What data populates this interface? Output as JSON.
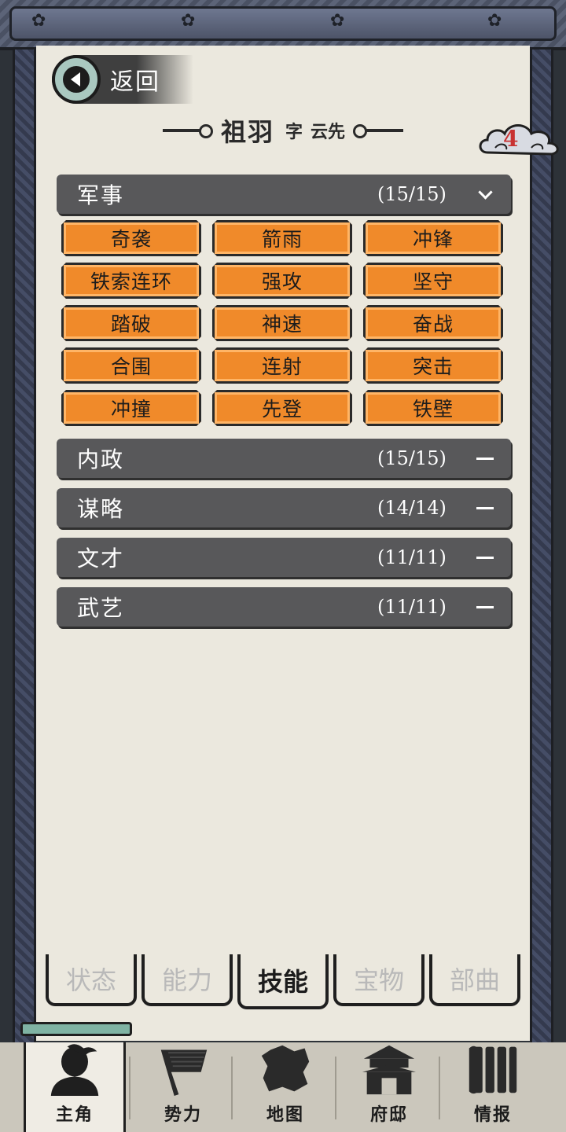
{
  "header": {
    "back_label": "返回",
    "name": "祖羽",
    "zi_label": "字",
    "zi": "云先",
    "badge_count": "4"
  },
  "categories": [
    {
      "name": "军事",
      "count": "(15/15)",
      "expanded": true,
      "skills": [
        "奇袭",
        "箭雨",
        "冲锋",
        "铁索连环",
        "强攻",
        "坚守",
        "踏破",
        "神速",
        "奋战",
        "合围",
        "连射",
        "突击",
        "冲撞",
        "先登",
        "铁壁"
      ]
    },
    {
      "name": "内政",
      "count": "(15/15)",
      "expanded": false
    },
    {
      "name": "谋略",
      "count": "(14/14)",
      "expanded": false
    },
    {
      "name": "文才",
      "count": "(11/11)",
      "expanded": false
    },
    {
      "name": "武艺",
      "count": "(11/11)",
      "expanded": false
    }
  ],
  "tabs": [
    {
      "label": "状态",
      "active": false
    },
    {
      "label": "能力",
      "active": false
    },
    {
      "label": "技能",
      "active": true
    },
    {
      "label": "宝物",
      "active": false
    },
    {
      "label": "部曲",
      "active": false
    }
  ],
  "bottom_nav": [
    {
      "label": "主角",
      "icon": "warrior-icon",
      "active": true
    },
    {
      "label": "势力",
      "icon": "flag-icon",
      "active": false
    },
    {
      "label": "地图",
      "icon": "map-icon",
      "active": false
    },
    {
      "label": "府邸",
      "icon": "mansion-icon",
      "active": false
    },
    {
      "label": "情报",
      "icon": "scroll-icon",
      "active": false
    }
  ],
  "colors": {
    "skill_orange": "#f08a2a",
    "category_bar": "#58585a",
    "badge_red": "#c83232",
    "accent_teal": "#a9c8c0"
  }
}
